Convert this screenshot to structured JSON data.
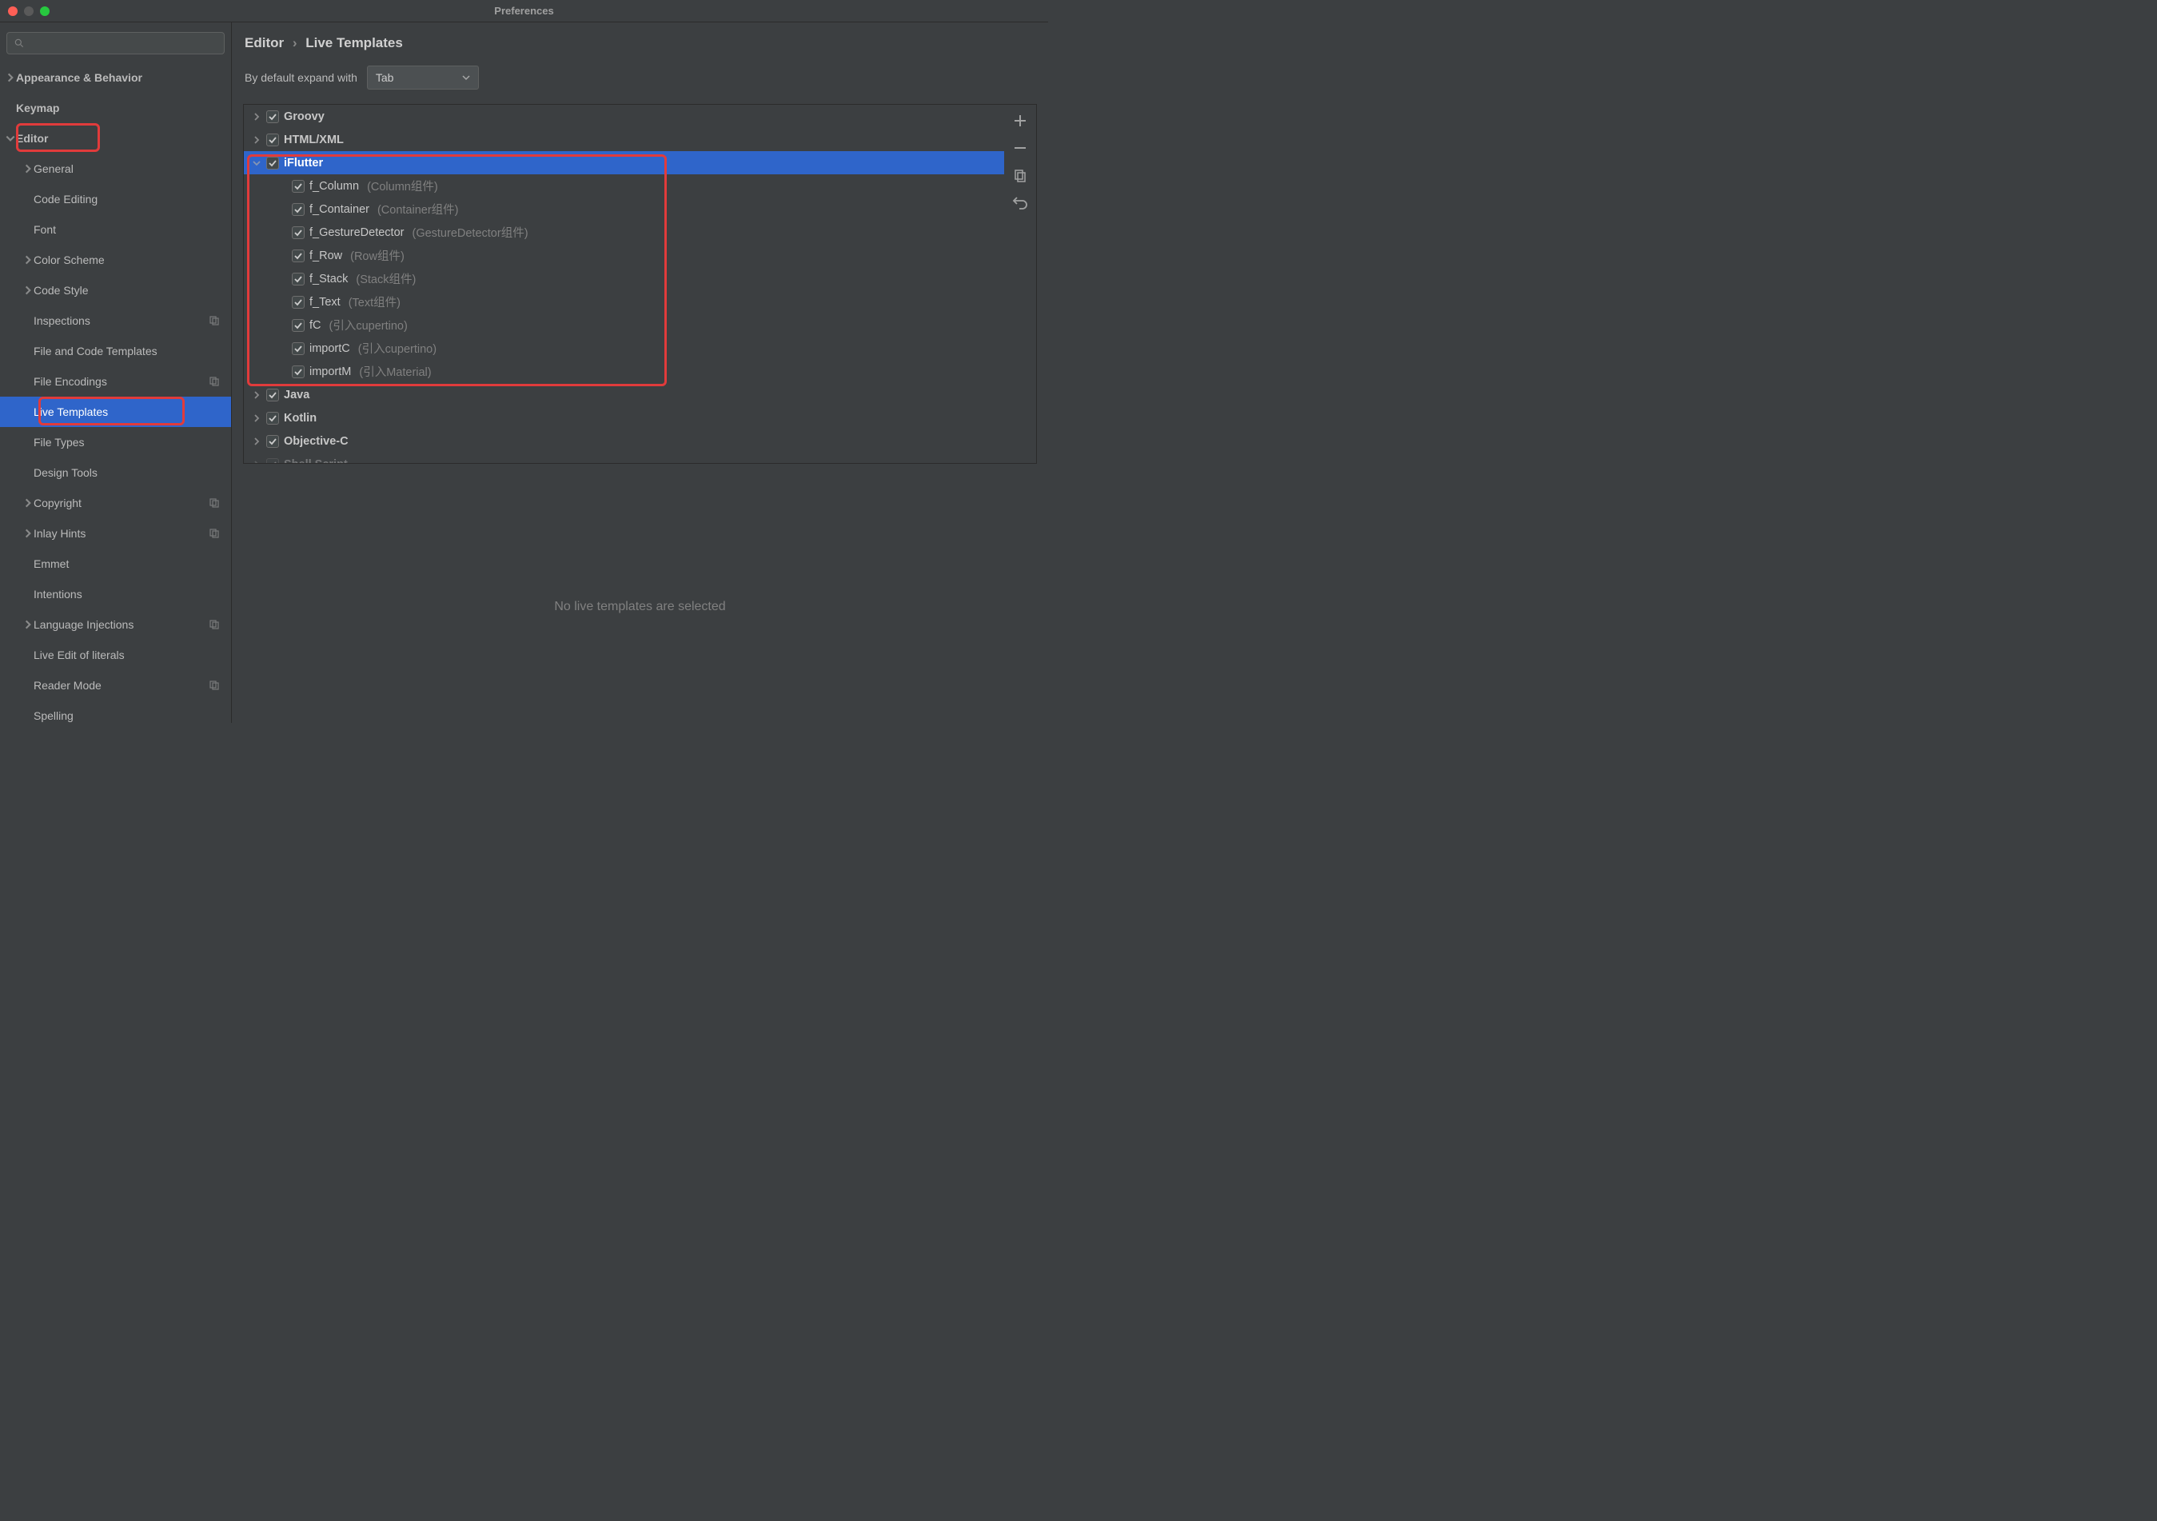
{
  "window": {
    "title": "Preferences"
  },
  "breadcrumb": {
    "parent": "Editor",
    "current": "Live Templates"
  },
  "expand": {
    "label": "By default expand with",
    "value": "Tab"
  },
  "sidebar": {
    "items": [
      {
        "label": "Appearance & Behavior",
        "chev": true,
        "bold": true
      },
      {
        "label": "Keymap",
        "bold": true
      },
      {
        "label": "Editor",
        "chev": "down",
        "bold": true,
        "redbox": true
      },
      {
        "label": "General",
        "lvl": 1,
        "chev": true
      },
      {
        "label": "Code Editing",
        "lvl": 1
      },
      {
        "label": "Font",
        "lvl": 1
      },
      {
        "label": "Color Scheme",
        "lvl": 1,
        "chev": true
      },
      {
        "label": "Code Style",
        "lvl": 1,
        "chev": true
      },
      {
        "label": "Inspections",
        "lvl": 1,
        "copy": true
      },
      {
        "label": "File and Code Templates",
        "lvl": 1
      },
      {
        "label": "File Encodings",
        "lvl": 1,
        "copy": true
      },
      {
        "label": "Live Templates",
        "lvl": 1,
        "selected": true,
        "redbox": true
      },
      {
        "label": "File Types",
        "lvl": 1
      },
      {
        "label": "Design Tools",
        "lvl": 1
      },
      {
        "label": "Copyright",
        "lvl": 1,
        "chev": true,
        "copy": true
      },
      {
        "label": "Inlay Hints",
        "lvl": 1,
        "chev": true,
        "copy": true
      },
      {
        "label": "Emmet",
        "lvl": 1
      },
      {
        "label": "Intentions",
        "lvl": 1
      },
      {
        "label": "Language Injections",
        "lvl": 1,
        "chev": true,
        "copy": true
      },
      {
        "label": "Live Edit of literals",
        "lvl": 1
      },
      {
        "label": "Reader Mode",
        "lvl": 1,
        "copy": true
      },
      {
        "label": "Spelling",
        "lvl": 1
      }
    ]
  },
  "templates": {
    "groups": [
      {
        "name": "Groovy",
        "expanded": false
      },
      {
        "name": "HTML/XML",
        "expanded": false
      },
      {
        "name": "iFlutter",
        "expanded": true,
        "selected": true,
        "children": [
          {
            "name": "f_Column",
            "desc": "(Column组件)"
          },
          {
            "name": "f_Container",
            "desc": "(Container组件)"
          },
          {
            "name": "f_GestureDetector",
            "desc": "(GestureDetector组件)"
          },
          {
            "name": "f_Row",
            "desc": "(Row组件)"
          },
          {
            "name": "f_Stack",
            "desc": "(Stack组件)"
          },
          {
            "name": "f_Text",
            "desc": "(Text组件)"
          },
          {
            "name": "fC",
            "desc": "(引入cupertino)"
          },
          {
            "name": "importC",
            "desc": "(引入cupertino)"
          },
          {
            "name": "importM",
            "desc": "(引入Material)"
          }
        ]
      },
      {
        "name": "Java",
        "expanded": false
      },
      {
        "name": "Kotlin",
        "expanded": false
      },
      {
        "name": "Objective-C",
        "expanded": false
      },
      {
        "name": "Shell Script",
        "expanded": false,
        "cut": true
      }
    ]
  },
  "empty_msg": "No live templates are selected"
}
